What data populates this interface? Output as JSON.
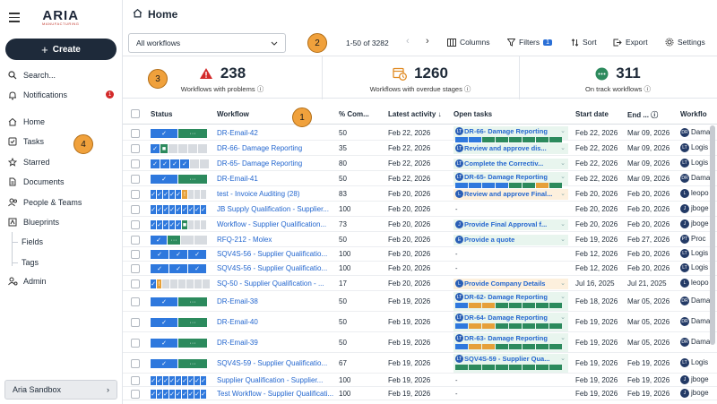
{
  "sidebar": {
    "logo_main": "ARIA",
    "logo_sub": "MANUFACTURING",
    "create_label": "Create",
    "search_label": "Search...",
    "notifications_label": "Notifications",
    "notifications_count": "1",
    "items": [
      {
        "label": "Home",
        "icon": "home-icon"
      },
      {
        "label": "Tasks",
        "icon": "tasks-icon"
      },
      {
        "label": "Starred",
        "icon": "star-icon"
      },
      {
        "label": "Documents",
        "icon": "document-icon"
      },
      {
        "label": "People & Teams",
        "icon": "people-icon"
      },
      {
        "label": "Blueprints",
        "icon": "blueprint-icon"
      },
      {
        "label": "Fields",
        "icon": ""
      },
      {
        "label": "Tags",
        "icon": ""
      },
      {
        "label": "Admin",
        "icon": "admin-icon"
      }
    ],
    "sandbox_label": "Aria Sandbox"
  },
  "callouts": [
    "1",
    "2",
    "3",
    "4"
  ],
  "header": {
    "title": "Home",
    "filter_value": "All workflows",
    "pager": "1-50 of 3282",
    "columns_label": "Columns",
    "filters_label": "Filters",
    "filters_count": "1",
    "sort_label": "Sort",
    "export_label": "Export",
    "settings_label": "Settings"
  },
  "stats": [
    {
      "value": "238",
      "label": "Workflows with problems",
      "color": "#d32a2a"
    },
    {
      "value": "1260",
      "label": "Workflows with overdue stages",
      "color": "#e08a22"
    },
    {
      "value": "311",
      "label": "On track workflows",
      "color": "#2c8a5d"
    }
  ],
  "table": {
    "headers": {
      "status": "Status",
      "workflow": "Workflow",
      "complete": "% Com...",
      "activity": "Latest activity",
      "tasks": "Open tasks",
      "start": "Start date",
      "end": "End ...",
      "owner": "Workflo"
    },
    "rows": [
      {
        "name": "DR-Email-42",
        "pct": "50",
        "activity": "Feb 22, 2026",
        "task": "DR-66- Damage Reporting",
        "task_av": [
          "LT"
        ],
        "start": "Feb 22, 2026",
        "end": "Mar 09, 2026",
        "owner_av": "DR",
        "owner": "Dama"
      },
      {
        "name": "DR-66- Damage Reporting",
        "pct": "35",
        "activity": "Feb 22, 2026",
        "task": "Review and approve dis...",
        "task_av": [
          "LT"
        ],
        "start": "Feb 22, 2026",
        "end": "Mar 09, 2026",
        "owner_av": "LT",
        "owner": "Logis"
      },
      {
        "name": "DR-65- Damage Reporting",
        "pct": "80",
        "activity": "Feb 22, 2026",
        "task": "Complete the Correctiv...",
        "task_av": [
          "LT"
        ],
        "start": "Feb 22, 2026",
        "end": "Mar 09, 2026",
        "owner_av": "LT",
        "owner": "Logis"
      },
      {
        "name": "DR-Email-41",
        "pct": "50",
        "activity": "Feb 22, 2026",
        "task": "DR-65- Damage Reporting",
        "task_av": [
          "LT"
        ],
        "start": "Feb 22, 2026",
        "end": "Mar 09, 2026",
        "owner_av": "DR",
        "owner": "Dama"
      },
      {
        "name": "test - Invoice Auditing (28)",
        "pct": "83",
        "activity": "Feb 20, 2026",
        "task": "Review and approve Final...",
        "task_av": [
          "L"
        ],
        "start": "Feb 20, 2026",
        "end": "Feb 20, 2026",
        "owner_av": "L",
        "owner": "leopo"
      },
      {
        "name": "JB Supply Qualification - Supplier...",
        "pct": "100",
        "activity": "Feb 20, 2026",
        "task": "-",
        "task_av": [],
        "start": "Feb 20, 2026",
        "end": "Feb 20, 2026",
        "owner_av": "J",
        "owner": "jboge"
      },
      {
        "name": "Workflow - Supplier Qualification...",
        "pct": "73",
        "activity": "Feb 20, 2026",
        "task": "Provide Final Approval f...",
        "task_av": [
          "J"
        ],
        "start": "Feb 20, 2026",
        "end": "Feb 20, 2026",
        "owner_av": "J",
        "owner": "jboge"
      },
      {
        "name": "RFQ-212 - Molex",
        "pct": "50",
        "activity": "Feb 20, 2026",
        "task": "Provide a quote",
        "task_av": [
          "E"
        ],
        "start": "Feb 19, 2026",
        "end": "Feb 27, 2026",
        "owner_av": "PT",
        "owner": "Proc"
      },
      {
        "name": "SQV4S-56 - Supplier Qualificatio...",
        "pct": "100",
        "activity": "Feb 20, 2026",
        "task": "-",
        "task_av": [],
        "start": "Feb 12, 2026",
        "end": "Feb 20, 2026",
        "owner_av": "LT",
        "owner": "Logis"
      },
      {
        "name": "SQV4S-56 - Supplier Qualificatio...",
        "pct": "100",
        "activity": "Feb 20, 2026",
        "task": "-",
        "task_av": [],
        "start": "Feb 12, 2026",
        "end": "Feb 20, 2026",
        "owner_av": "LT",
        "owner": "Logis"
      },
      {
        "name": "SQ-50 - Supplier Qualification - ...",
        "pct": "17",
        "activity": "Feb 20, 2026",
        "task": "Provide Company Details",
        "task_av": [
          "L"
        ],
        "start": "Jul 16, 2025",
        "end": "Jul 21, 2025",
        "owner_av": "L",
        "owner": "leopo"
      },
      {
        "name": "DR-Email-38",
        "pct": "50",
        "activity": "Feb 19, 2026",
        "task": "DR-62- Damage Reporting",
        "task_av": [
          "LT"
        ],
        "start": "Feb 18, 2026",
        "end": "Mar 05, 2026",
        "owner_av": "DR",
        "owner": "Dama"
      },
      {
        "name": "DR-Email-40",
        "pct": "50",
        "activity": "Feb 19, 2026",
        "task": "DR-64- Damage Reporting",
        "task_av": [
          "LT"
        ],
        "start": "Feb 19, 2026",
        "end": "Mar 05, 2026",
        "owner_av": "DR",
        "owner": "Dama"
      },
      {
        "name": "DR-Email-39",
        "pct": "50",
        "activity": "Feb 19, 2026",
        "task": "DR-63- Damage Reporting",
        "task_av": [
          "LT"
        ],
        "start": "Feb 19, 2026",
        "end": "Mar 05, 2026",
        "owner_av": "DR",
        "owner": "Dama"
      },
      {
        "name": "SQV4S-59 - Supplier Qualificatio...",
        "pct": "67",
        "activity": "Feb 19, 2026",
        "task": "SQV4S-59 - Supplier Qua...",
        "task_av": [
          "LT"
        ],
        "start": "Feb 19, 2026",
        "end": "Feb 19, 2026",
        "owner_av": "LT",
        "owner": "Logis"
      },
      {
        "name": "Supplier Qualification - Supplier...",
        "pct": "100",
        "activity": "Feb 19, 2026",
        "task": "-",
        "task_av": [],
        "start": "Feb 19, 2026",
        "end": "Feb 19, 2026",
        "owner_av": "J",
        "owner": "jboge"
      },
      {
        "name": "Test Workflow - Supplier Qualificati...",
        "pct": "100",
        "activity": "Feb 19, 2026",
        "task": "-",
        "task_av": [],
        "start": "Feb 19, 2026",
        "end": "Feb 19, 2026",
        "owner_av": "J",
        "owner": "jboge"
      }
    ]
  }
}
